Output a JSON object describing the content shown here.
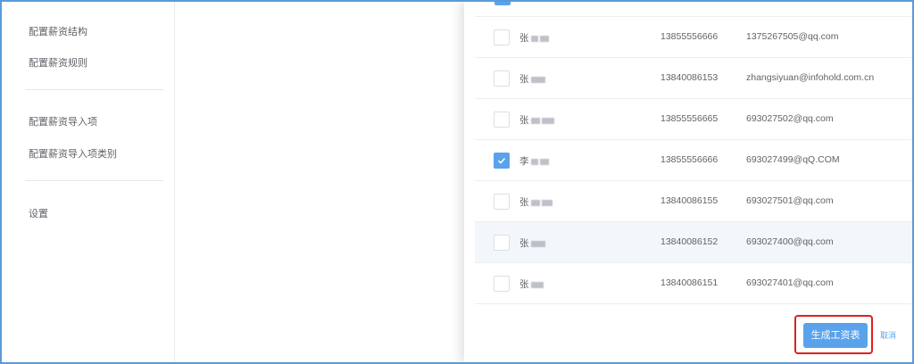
{
  "sidebar": {
    "items": [
      {
        "label": "配置薪资结构"
      },
      {
        "label": "配置薪资规则"
      },
      {
        "label": "配置薪资导入项"
      },
      {
        "label": "配置薪资导入项类别"
      },
      {
        "label": "设置"
      }
    ]
  },
  "employees": {
    "rows": [
      {
        "name": "张",
        "phone": "13855556666",
        "email": "1375267505@qq.com",
        "checked": false
      },
      {
        "name": "张",
        "phone": "13840086153",
        "email": "zhangsiyuan@infohold.com.cn",
        "checked": false
      },
      {
        "name": "张",
        "phone": "13855556665",
        "email": "693027502@qq.com",
        "checked": false
      },
      {
        "name": "李",
        "phone": "13855556666",
        "email": "693027499@qQ.COM",
        "checked": true
      },
      {
        "name": "张",
        "phone": "13840086155",
        "email": "693027501@qq.com",
        "checked": false
      },
      {
        "name": "张",
        "phone": "13840086152",
        "email": "693027400@qq.com",
        "checked": false
      },
      {
        "name": "张",
        "phone": "13840086151",
        "email": "693027401@qq.com",
        "checked": false
      }
    ]
  },
  "footer": {
    "generate_label": "生成工资表",
    "cancel_label": "取消"
  },
  "colors": {
    "accent": "#5aa3ec",
    "highlight": "#e02020",
    "frame": "#5b9ad8"
  }
}
